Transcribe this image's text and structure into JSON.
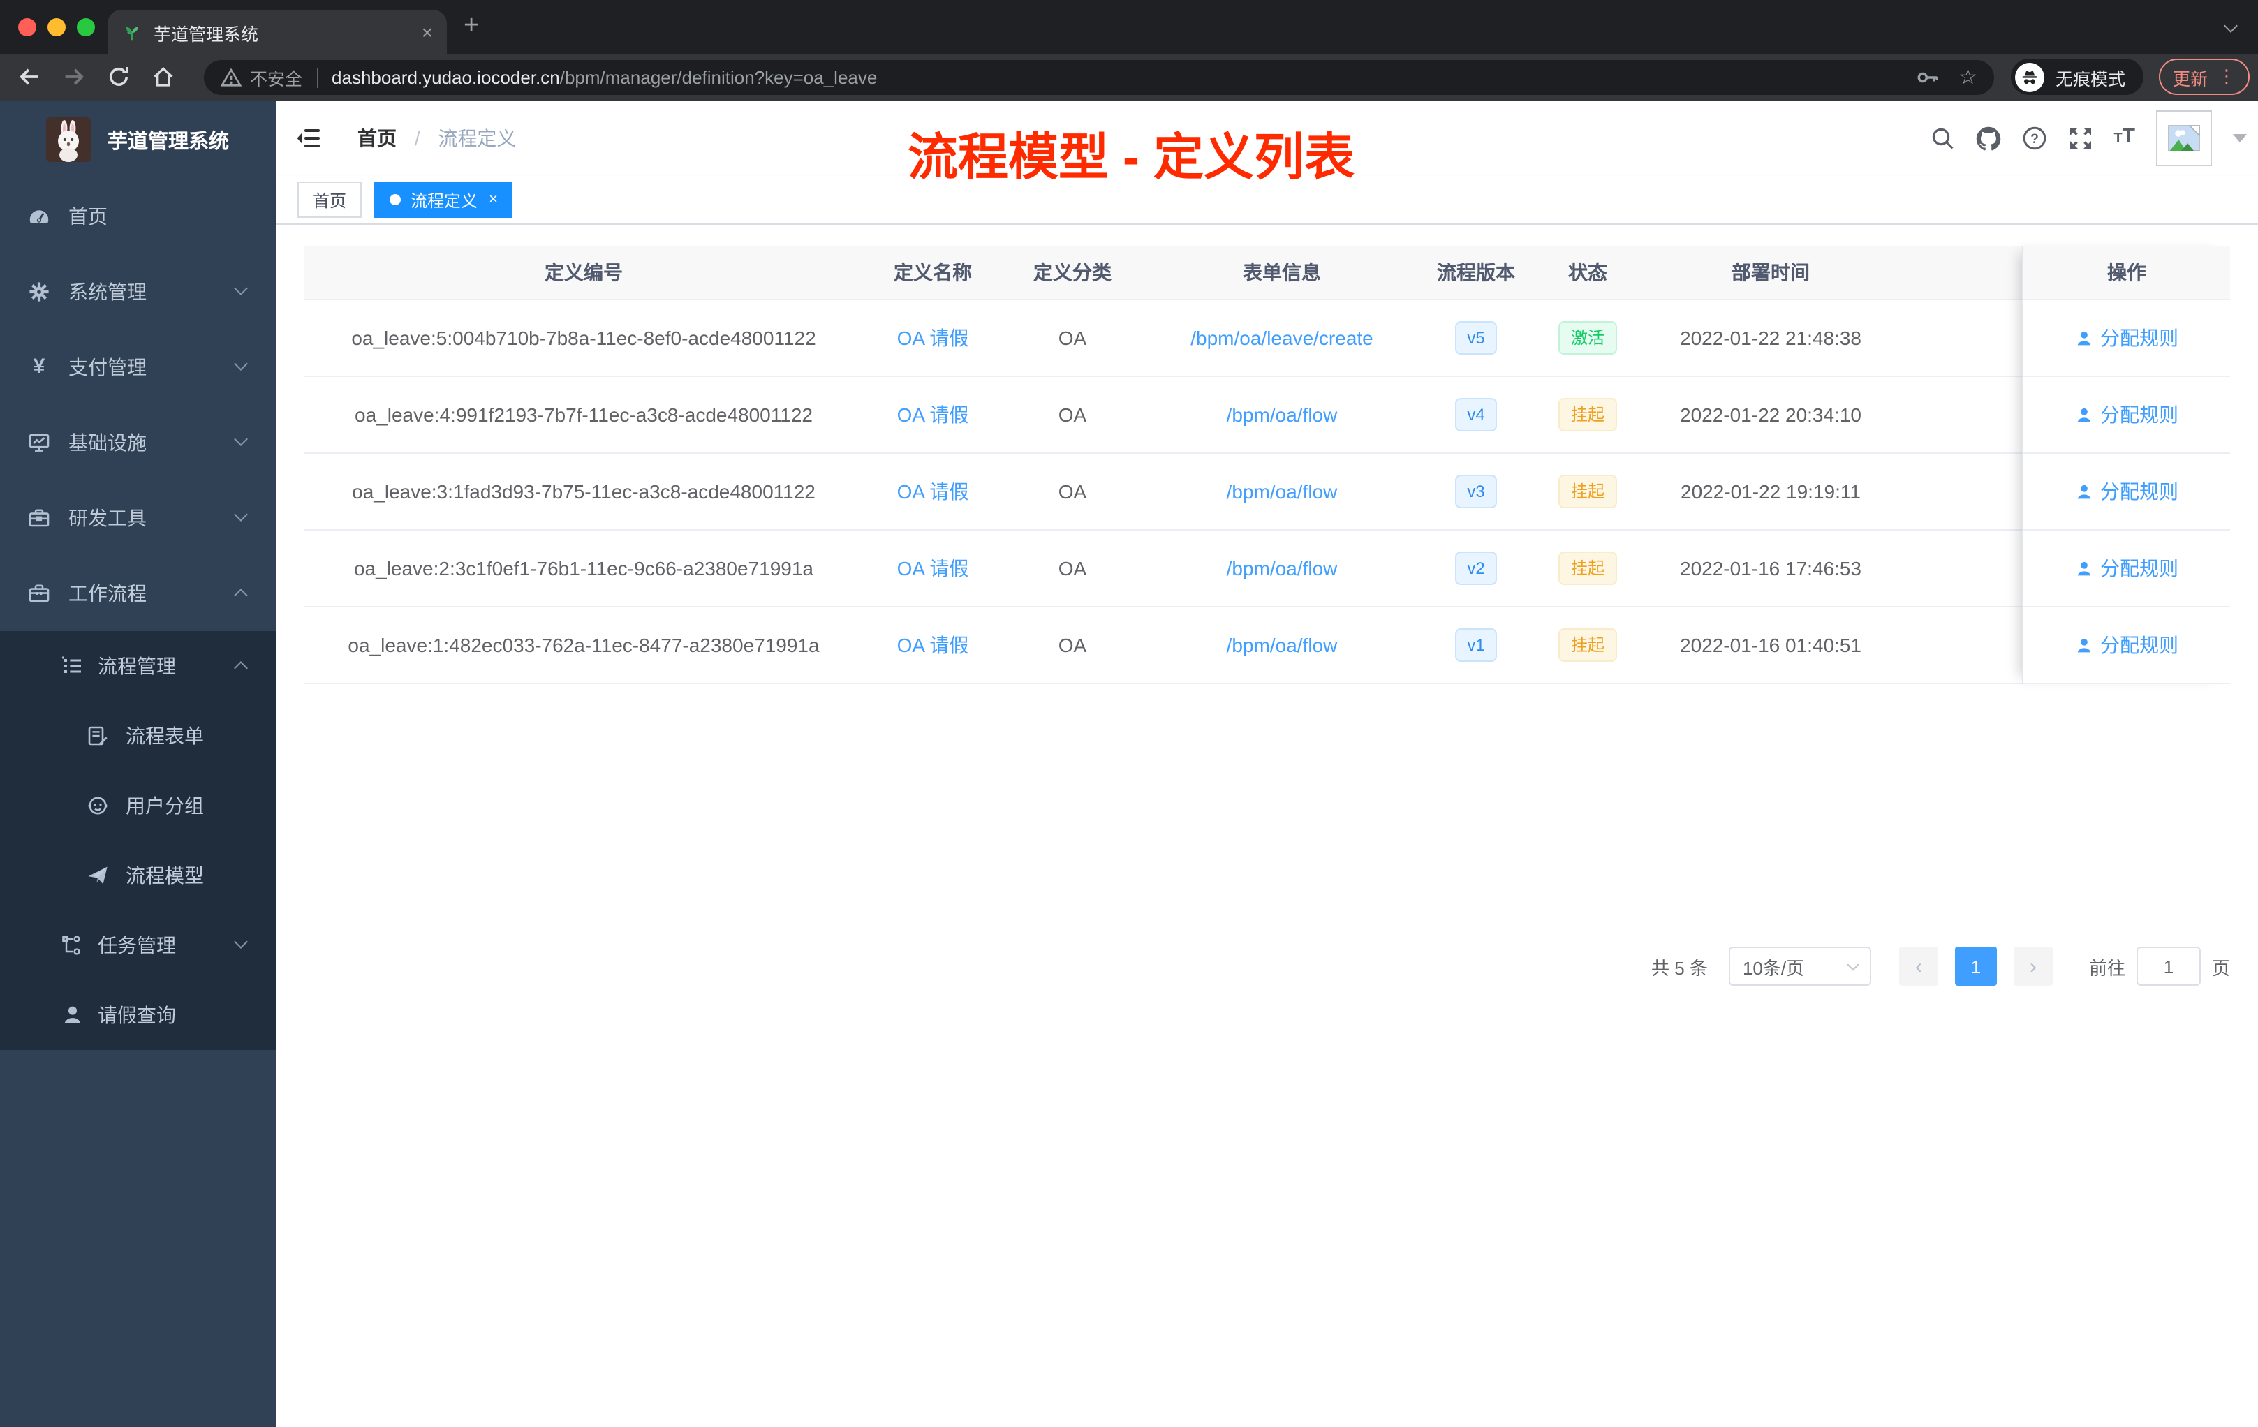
{
  "browser": {
    "tab_title": "芋道管理系统",
    "tab_close": "×",
    "new_tab": "+",
    "security_label": "不安全",
    "url_domain": "dashboard.yudao.iocoder.cn",
    "url_path": "/bpm/manager/definition?key=oa_leave",
    "incognito_label": "无痕模式",
    "update_label": "更新",
    "menu_dots": "⋮",
    "star": "☆"
  },
  "sidebar": {
    "logo_title": "芋道管理系统",
    "items": [
      {
        "label": "首页",
        "icon": "dashboard-icon"
      },
      {
        "label": "系统管理",
        "icon": "gear-icon",
        "chevron": "down"
      },
      {
        "label": "支付管理",
        "icon": "yen-icon",
        "chevron": "down"
      },
      {
        "label": "基础设施",
        "icon": "monitor-icon",
        "chevron": "down"
      },
      {
        "label": "研发工具",
        "icon": "toolbox-icon",
        "chevron": "down"
      },
      {
        "label": "工作流程",
        "icon": "briefcase-icon",
        "chevron": "up"
      },
      {
        "label": "流程管理",
        "icon": "list-icon",
        "chevron": "up"
      },
      {
        "label": "流程表单",
        "icon": "form-icon"
      },
      {
        "label": "用户分组",
        "icon": "user-group-icon"
      },
      {
        "label": "流程模型",
        "icon": "paper-plane-icon"
      },
      {
        "label": "任务管理",
        "icon": "tree-icon",
        "chevron": "down"
      },
      {
        "label": "请假查询",
        "icon": "person-icon"
      }
    ]
  },
  "navbar": {
    "breadcrumb_home": "首页",
    "breadcrumb_separator": "/",
    "breadcrumb_current": "流程定义"
  },
  "overlay_title": "流程模型 - 定义列表",
  "tags": [
    {
      "label": "首页"
    },
    {
      "label": "流程定义",
      "close": "×"
    }
  ],
  "table": {
    "headers": [
      "定义编号",
      "定义名称",
      "定义分类",
      "表单信息",
      "流程版本",
      "状态",
      "部署时间",
      "操作"
    ],
    "action_label": "分配规则",
    "rows": [
      {
        "id": "oa_leave:5:004b710b-7b8a-11ec-8ef0-acde48001122",
        "name": "OA 请假",
        "category": "OA",
        "form": "/bpm/oa/leave/create",
        "version": "v5",
        "status": "激活",
        "status_type": "success",
        "deploy_time": "2022-01-22 21:48:38"
      },
      {
        "id": "oa_leave:4:991f2193-7b7f-11ec-a3c8-acde48001122",
        "name": "OA 请假",
        "category": "OA",
        "form": "/bpm/oa/flow",
        "version": "v4",
        "status": "挂起",
        "status_type": "warning",
        "deploy_time": "2022-01-22 20:34:10"
      },
      {
        "id": "oa_leave:3:1fad3d93-7b75-11ec-a3c8-acde48001122",
        "name": "OA 请假",
        "category": "OA",
        "form": "/bpm/oa/flow",
        "version": "v3",
        "status": "挂起",
        "status_type": "warning",
        "deploy_time": "2022-01-22 19:19:11"
      },
      {
        "id": "oa_leave:2:3c1f0ef1-76b1-11ec-9c66-a2380e71991a",
        "name": "OA 请假",
        "category": "OA",
        "form": "/bpm/oa/flow",
        "version": "v2",
        "status": "挂起",
        "status_type": "warning",
        "deploy_time": "2022-01-16 17:46:53"
      },
      {
        "id": "oa_leave:1:482ec033-762a-11ec-8477-a2380e71991a",
        "name": "OA 请假",
        "category": "OA",
        "form": "/bpm/oa/flow",
        "version": "v1",
        "status": "挂起",
        "status_type": "warning",
        "deploy_time": "2022-01-16 01:40:51"
      }
    ]
  },
  "pagination": {
    "total": "共 5 条",
    "page_size": "10条/页",
    "prev": "‹",
    "page": "1",
    "next": "›",
    "goto_label": "前往",
    "goto_value": "1",
    "goto_unit": "页"
  },
  "colors": {
    "accent_blue": "#409eff",
    "tag_active_blue": "#1890ff",
    "status_active_green": "#13ce66",
    "status_suspend_orange": "#f0a020",
    "annotation_red": "#ff2b00",
    "sidebar_bg": "#304156",
    "sidebar_submenu_bg": "#1f2d3d",
    "chrome_update_red": "#f28b82"
  }
}
